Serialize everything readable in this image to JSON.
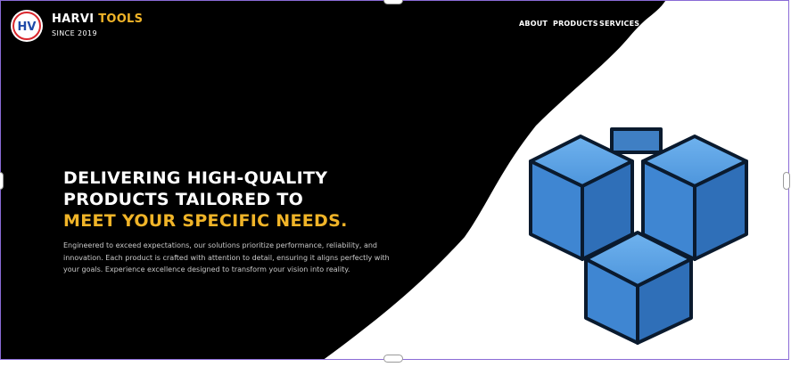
{
  "brand": {
    "logo_text": "HV",
    "name_part1": "HARVI",
    "name_part2": "TOOLS",
    "tagline": "SINCE 2019"
  },
  "nav": {
    "about": "ABOUT",
    "products": "PRODUCTS",
    "services": "SERVICES"
  },
  "hero": {
    "line1": "DELIVERING HIGH-QUALITY",
    "line2": "PRODUCTS TAILORED TO",
    "line3": "MEET YOUR SPECIFIC NEEDS.",
    "paragraph": "Engineered to exceed expectations, our solutions prioritize performance, reliability, and innovation. Each product is crafted with attention to detail, ensuring it aligns perfectly with your goals. Experience excellence designed to transform your vision into reality.",
    "image_icon": "stacked-blocks-icon"
  },
  "colors": {
    "accent": "#f0b428",
    "background_dark": "#000000",
    "block_blue": "#4a90d9",
    "selection_border": "#8a6bd6"
  }
}
